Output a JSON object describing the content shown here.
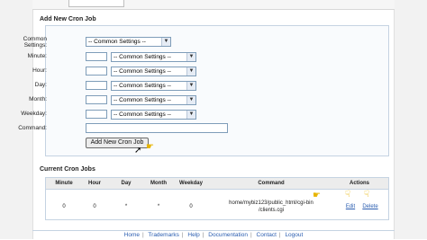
{
  "add_section": {
    "title": "Add New Cron Job",
    "common_settings_label": "Common Settings:",
    "common_settings_value": "-- Common Settings --",
    "fields": [
      {
        "label": "Minute:",
        "select": "-- Common Settings --"
      },
      {
        "label": "Hour:",
        "select": "-- Common Settings --"
      },
      {
        "label": "Day:",
        "select": "-- Common Settings --"
      },
      {
        "label": "Month:",
        "select": "-- Common Settings --"
      },
      {
        "label": "Weekday:",
        "select": "-- Common Settings --"
      }
    ],
    "command_label": "Command:",
    "add_button": "Add New Cron Job"
  },
  "current_section": {
    "title": "Current Cron Jobs",
    "headers": [
      "Minute",
      "Hour",
      "Day",
      "Month",
      "Weekday",
      "Command",
      "Actions"
    ],
    "rows": [
      {
        "minute": "0",
        "hour": "0",
        "day": "*",
        "month": "*",
        "weekday": "0",
        "command_line1": "home/mybiz123/public_html/cgi-bin",
        "command_line2": "/clients.cgi",
        "edit": "Edit",
        "delete": "Delete"
      }
    ]
  },
  "footer": {
    "links": [
      "Home",
      "Trademarks",
      "Help",
      "Documentation",
      "Contact",
      "Logout"
    ]
  },
  "colors": {
    "accent": "#2a5db0",
    "pointer": "#e7b400"
  },
  "icons": {
    "pointer": "hand-pointer-icon",
    "cursor": "mouse-cursor-icon",
    "arrow": "chevron-down-icon"
  }
}
